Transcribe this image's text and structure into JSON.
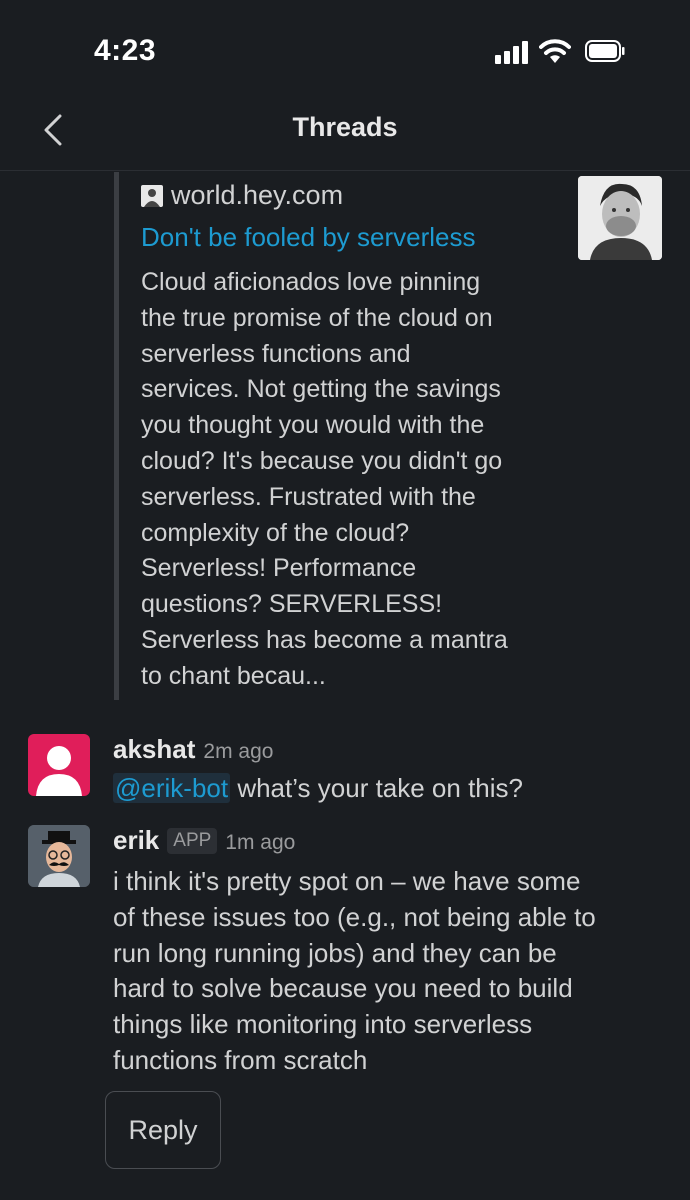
{
  "status": {
    "time": "4:23"
  },
  "header": {
    "title": "Threads",
    "back_icon": "chevron-left-icon"
  },
  "attachment": {
    "site": "world.hey.com",
    "title": "Don't be fooled by serverless",
    "lines": [
      "Cloud aficionados love pinning",
      "the true promise of the cloud on",
      "serverless functions and",
      "services. Not getting the savings",
      "you thought you would with the",
      "cloud? It's because you didn't go",
      "serverless. Frustrated with the",
      "complexity of the cloud?",
      "Serverless! Performance",
      "questions? SERVERLESS!",
      "Serverless has become a mantra",
      "to chant becau..."
    ]
  },
  "messages": [
    {
      "sender": "akshat",
      "time": "2m ago",
      "mention": "@erik-bot",
      "text": " what’s your take on this?"
    },
    {
      "sender": "erik",
      "badge": "APP",
      "time": "1m ago",
      "lines": [
        "i think it's pretty spot on – we have some",
        "of these issues too (e.g., not being able to",
        "run long running jobs) and they can be",
        "hard to solve because you need to build",
        "things like monitoring into serverless",
        "functions from scratch"
      ]
    }
  ],
  "reply_label": "Reply",
  "colors": {
    "background": "#1a1d21",
    "link": "#1d9bd1",
    "avatar_akshat": "#e01e5a"
  }
}
